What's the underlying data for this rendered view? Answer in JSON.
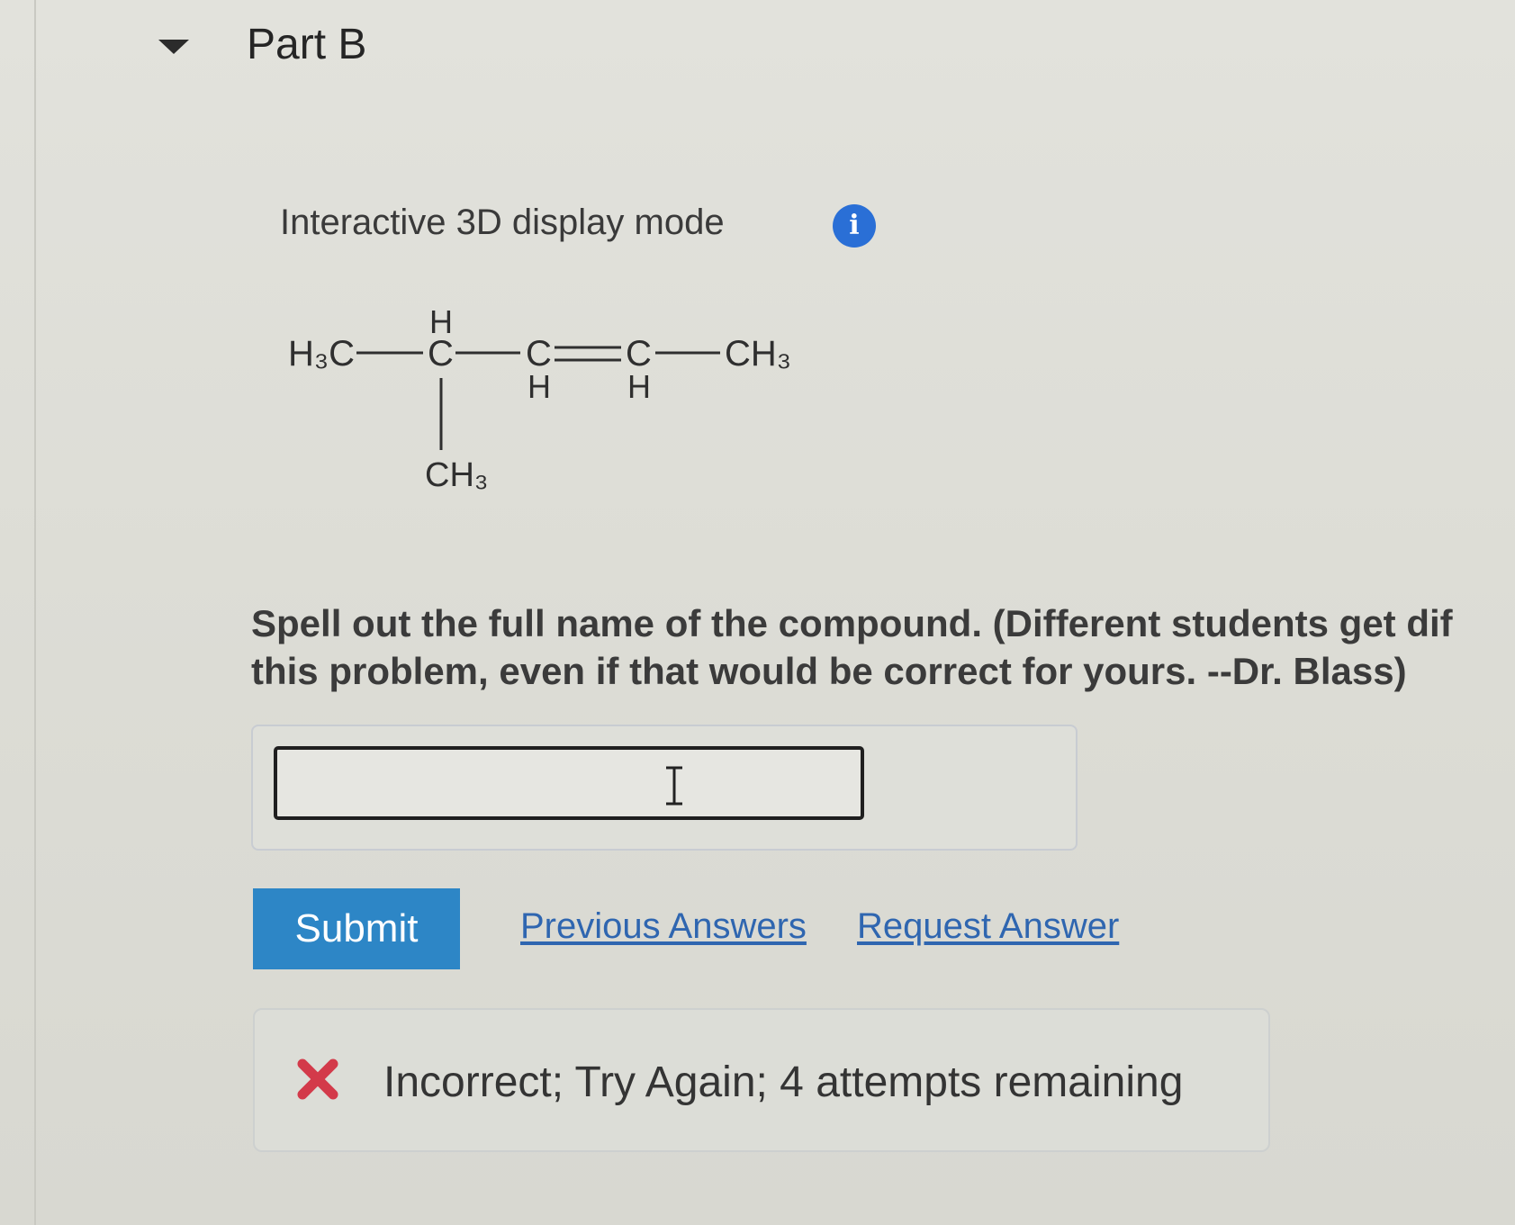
{
  "part": {
    "title": "Part B"
  },
  "display_mode": {
    "label": "Interactive 3D display mode",
    "info_icon": "info-icon"
  },
  "molecule": {
    "atoms": {
      "h3c_left": "H₃C",
      "h_top": "H",
      "c1": "C",
      "c2": "C",
      "c3": "C",
      "h_c2": "H",
      "h_c3": "H",
      "ch3_right": "CH₃",
      "ch3_bottom": "CH₃"
    }
  },
  "question": {
    "line1": "Spell out the full name of the compound. (Different students get dif",
    "line2": "this problem, even if that would be correct for yours. --Dr. Blass)"
  },
  "answer": {
    "value": "",
    "placeholder": ""
  },
  "actions": {
    "submit_label": "Submit",
    "previous_answers_label": "Previous Answers",
    "request_answer_label": "Request Answer"
  },
  "feedback": {
    "text": "Incorrect; Try Again; 4 attempts remaining",
    "status_color": "#d33a4a"
  },
  "colors": {
    "accent": "#2d86c6",
    "link": "#2f66b0",
    "info": "#2a6fd6"
  }
}
